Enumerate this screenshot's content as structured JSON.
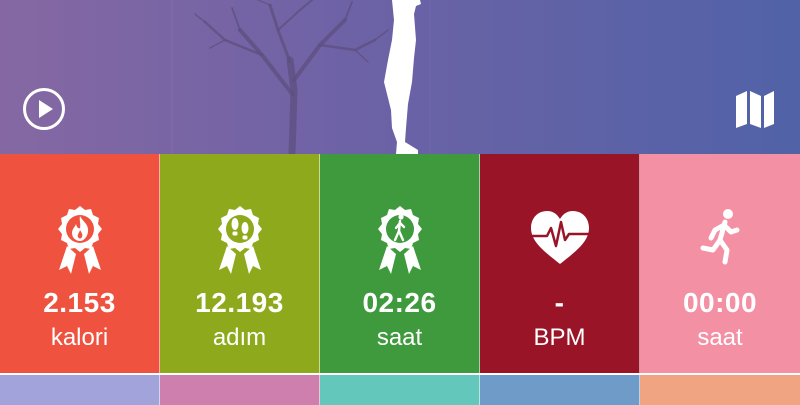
{
  "header": {
    "play_icon": "play-circle-icon",
    "map_icon": "map-icon",
    "background_colors": [
      "#8568a3",
      "#5162a7"
    ]
  },
  "tiles": [
    {
      "value": "2.153",
      "unit": "kalori",
      "icon": "calorie-badge-icon",
      "color": "#ef5340"
    },
    {
      "value": "12.193",
      "unit": "adım",
      "icon": "steps-badge-icon",
      "color": "#8eaa1c"
    },
    {
      "value": "02:26",
      "unit": "saat",
      "icon": "walking-badge-icon",
      "color": "#3f9a3d"
    },
    {
      "value": "-",
      "unit": "BPM",
      "icon": "heart-rate-icon",
      "color": "#9a1428"
    },
    {
      "value": "00:00",
      "unit": "saat",
      "icon": "running-icon",
      "color": "#f390a4"
    }
  ],
  "bottom_tiles": [
    {
      "color": "#a3a3dc"
    },
    {
      "color": "#cf7fae"
    },
    {
      "color": "#64c7bb"
    },
    {
      "color": "#6f9bc8"
    },
    {
      "color": "#f0a481"
    }
  ]
}
